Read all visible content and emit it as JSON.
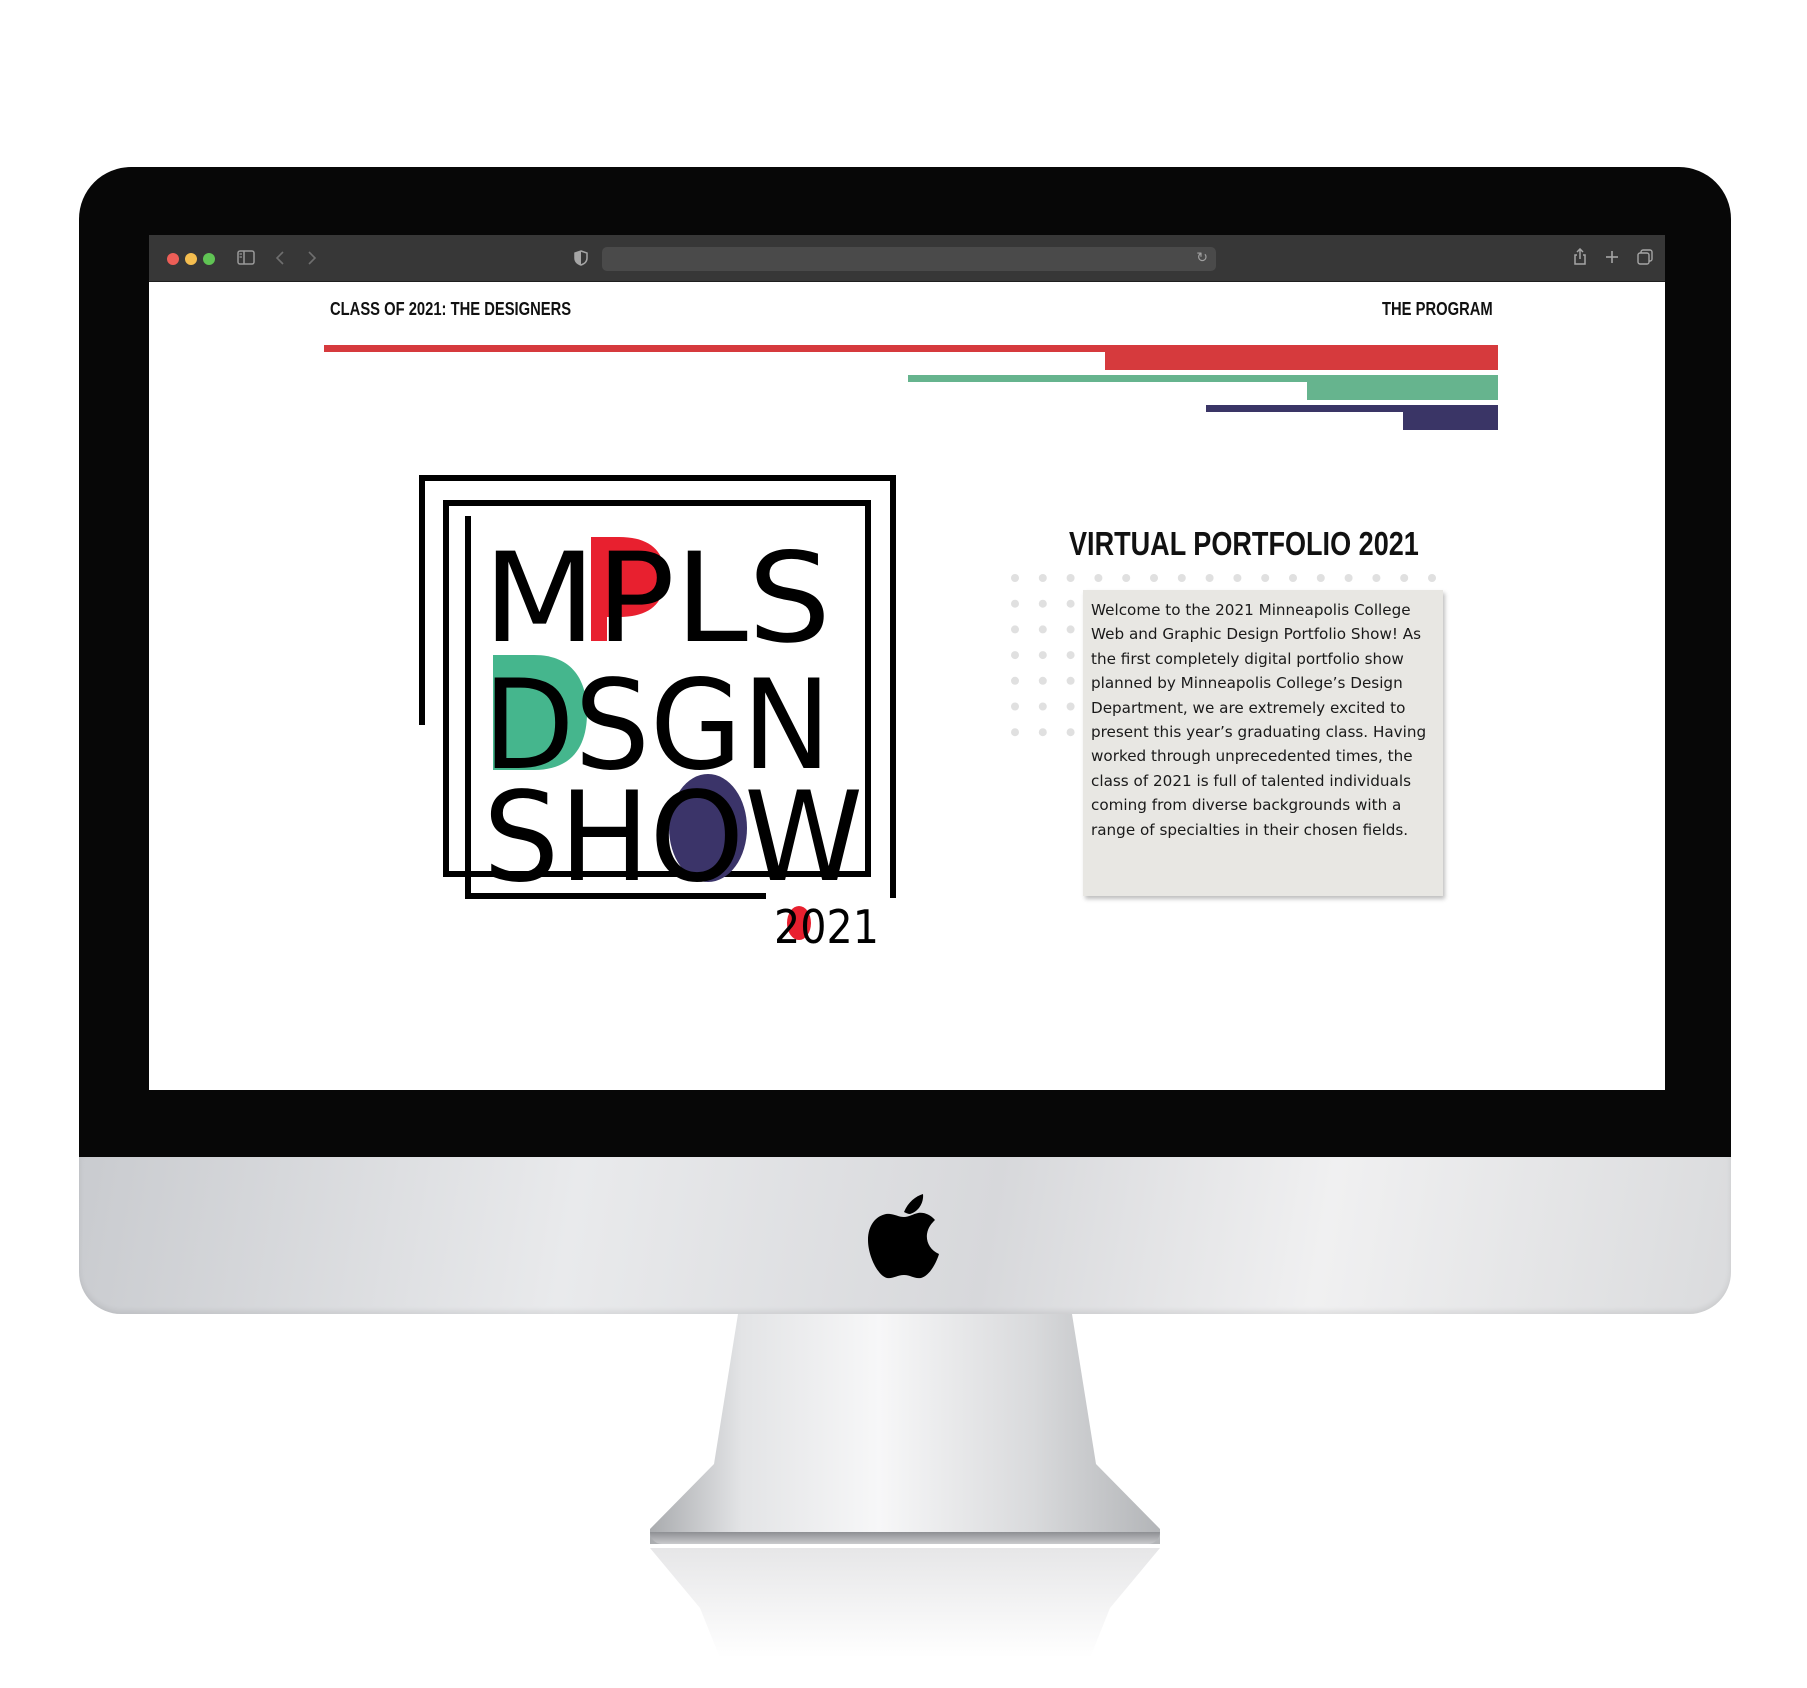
{
  "browser": {
    "window_controls": [
      "close",
      "minimize",
      "zoom"
    ],
    "icons": [
      "sidebar-icon",
      "back-icon",
      "forward-icon",
      "shield-icon",
      "reload-icon",
      "share-icon",
      "new-tab-icon",
      "tabs-overview-icon"
    ],
    "address_value": ""
  },
  "page": {
    "nav": {
      "left_link": "CLASS OF 2021: THE DESIGNERS",
      "right_link": "THE PROGRAM"
    },
    "accent_colors": {
      "red": "#d63a3d",
      "green": "#66b48e",
      "navy": "#3a3566"
    },
    "logo": {
      "line1": "MPLS",
      "line2": "DSGN",
      "line3": "SHOW",
      "year": "2021",
      "colors": {
        "p": "#e8202f",
        "d": "#45b68d",
        "o": "#3b3469",
        "zero": "#e8202f"
      }
    },
    "section": {
      "heading": "VIRTUAL PORTFOLIO 2021",
      "body": "Welcome to the 2021 Minneapolis College Web and Graphic Design Portfolio Show! As the first completely digital portfolio show planned by Minneapolis College’s Design Department, we are extremely excited to present this year’s graduating class. Having worked through unprecedented times, the class of 2021 is full of talented individuals coming from diverse backgrounds with a range of specialties in their chosen fields."
    }
  }
}
